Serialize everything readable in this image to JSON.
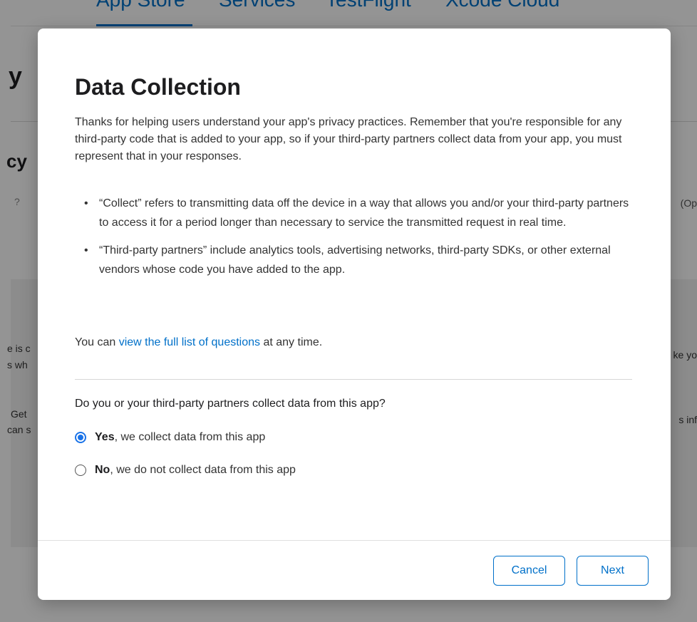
{
  "background": {
    "logo": "",
    "tabs": [
      "App Store",
      "Services",
      "TestFlight",
      "Xcode Cloud"
    ],
    "heading_fragment": "y",
    "section_fragment": "cy",
    "question_mark": "?",
    "op_fragment": "(Op",
    "text_fragments": {
      "left_1": "e is c",
      "left_2": "s wh",
      "left_3": "Get",
      "left_4": "can s",
      "right_1": "ke yo",
      "right_2": "s inf"
    }
  },
  "modal": {
    "title": "Data Collection",
    "intro": "Thanks for helping users understand your app's privacy practices. Remember that you're responsible for any third-party code that is added to your app, so if your third-party partners collect data from your app, you must represent that in your responses.",
    "bullets": [
      "“Collect” refers to transmitting data off the device in a way that allows you and/or your third-party partners to access it for a period longer than necessary to service the transmitted request in real time.",
      "“Third-party partners” include analytics tools, advertising networks, third-party SDKs, or other external vendors whose code you have added to the app."
    ],
    "bullet_char": "•",
    "view_prefix": "You can ",
    "view_link": "view the full list of questions",
    "view_suffix": " at any time.",
    "question": "Do you or your third-party partners collect data from this app?",
    "options": [
      {
        "bold": "Yes",
        "rest": ", we collect data from this app",
        "selected": true
      },
      {
        "bold": "No",
        "rest": ", we do not collect data from this app",
        "selected": false
      }
    ],
    "buttons": {
      "cancel": "Cancel",
      "next": "Next"
    }
  },
  "colors": {
    "accent": "#0070c9",
    "radio": "#1a73e8"
  }
}
